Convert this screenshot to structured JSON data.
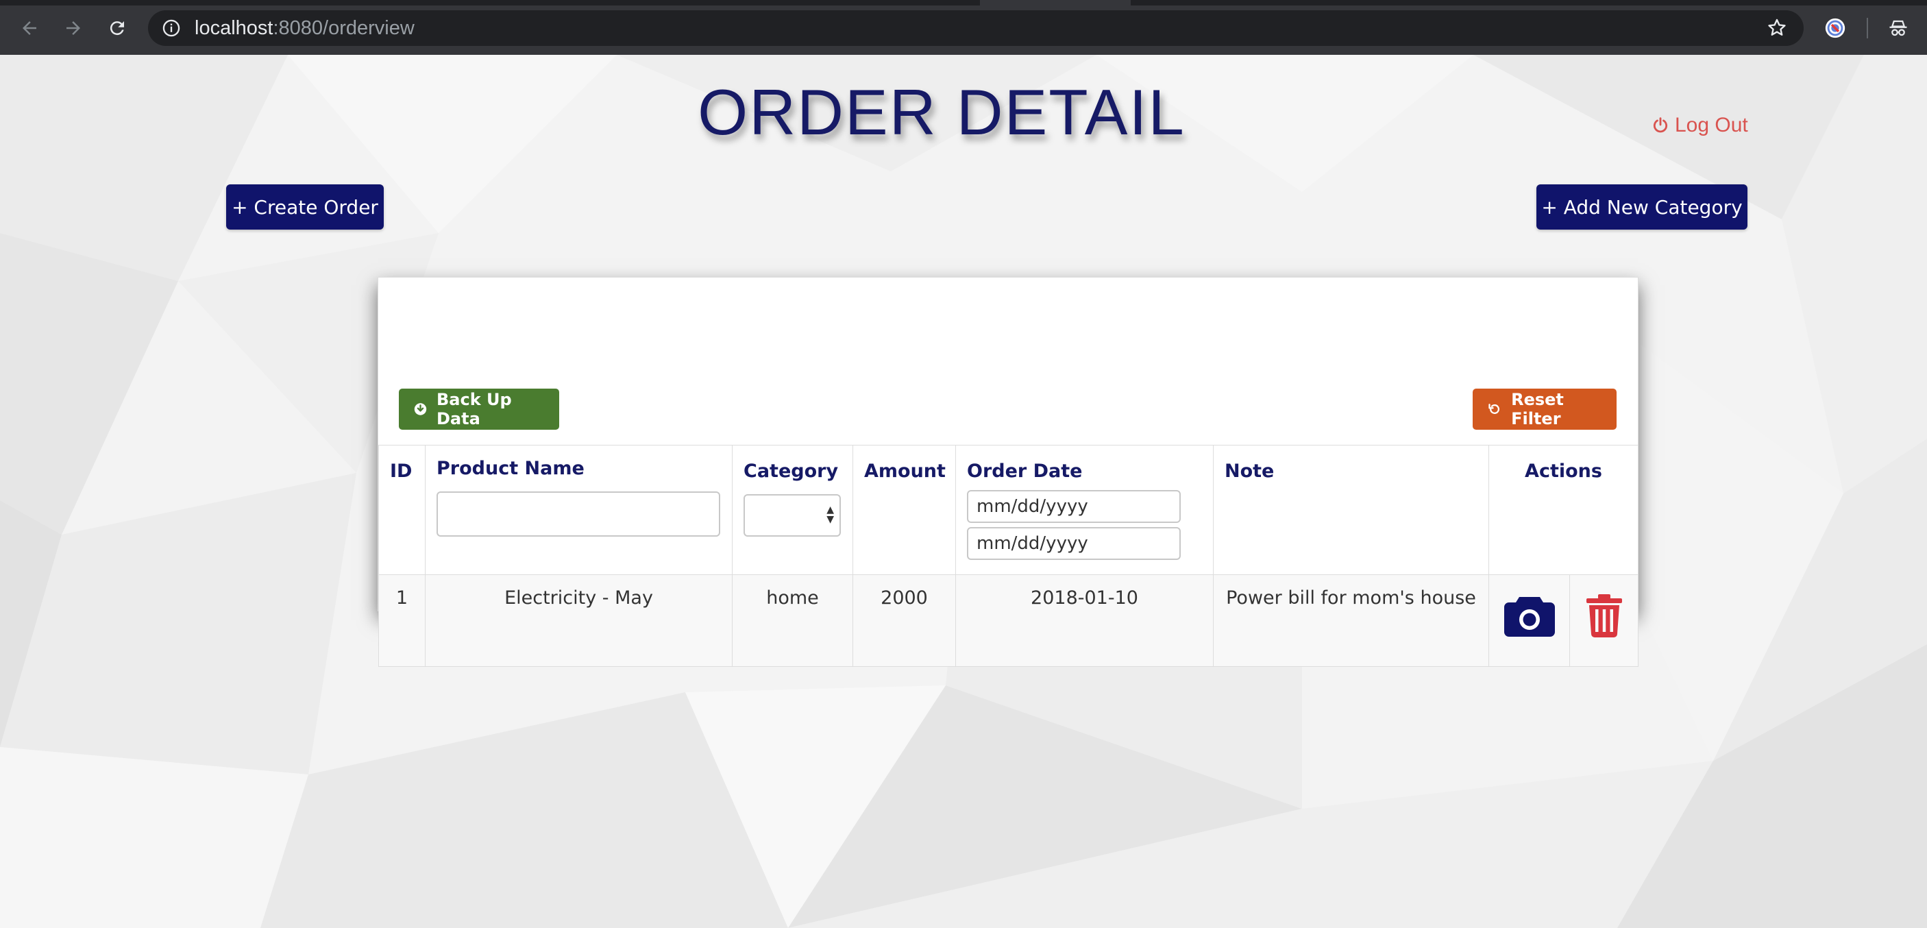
{
  "browser": {
    "url_host": "localhost",
    "url_path": ":8080/orderview"
  },
  "page": {
    "title": "ORDER DETAIL",
    "logout_label": "Log Out",
    "create_order_label": "+ Create Order",
    "add_category_label": "+ Add New Category",
    "backup_label": "Back Up Data",
    "reset_filter_label": "Reset Filter"
  },
  "colors": {
    "navy": "#10146b",
    "title": "#161a66",
    "logout": "#d9534f",
    "backup_green": "#4a7c2f",
    "reset_orange": "#d2581f",
    "delete_red": "#d9363e"
  },
  "table": {
    "headers": {
      "id": "ID",
      "product_name": "Product Name",
      "category": "Category",
      "amount": "Amount",
      "order_date": "Order Date",
      "note": "Note",
      "actions": "Actions"
    },
    "filters": {
      "product_name_value": "",
      "category_selected": "",
      "date_from_placeholder": "mm/dd/yyyy",
      "date_to_placeholder": "mm/dd/yyyy"
    },
    "rows": [
      {
        "id": "1",
        "product_name": "Electricity - May",
        "category": "home",
        "amount": "2000",
        "order_date": "2018-01-10",
        "note": "Power bill for mom's house",
        "actions": [
          "camera-icon",
          "trash-icon"
        ]
      }
    ]
  }
}
